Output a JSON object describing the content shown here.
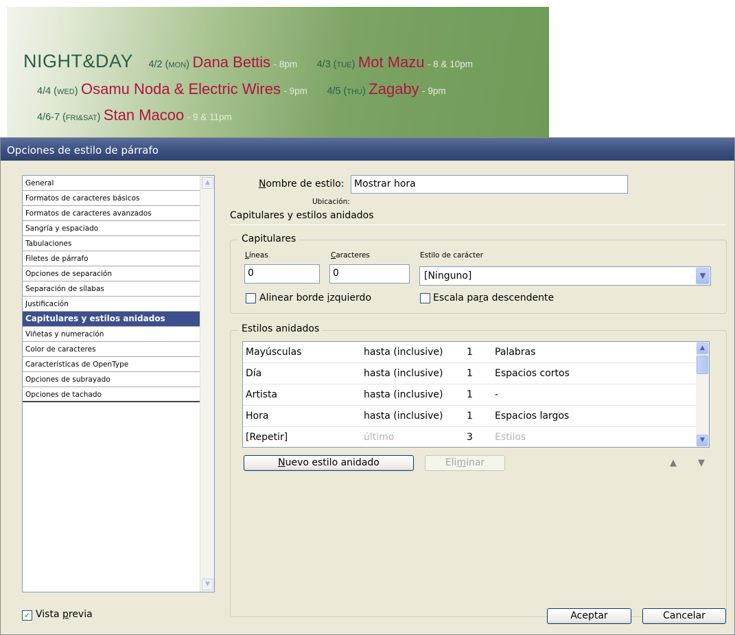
{
  "banner": {
    "title": "NIGHT&DAY",
    "lines": [
      [
        {
          "date_pre": "4/2 (",
          "day_sc": "Mon",
          "date_post": ")",
          "artist": "Dana Bettis",
          "time": "- 8pm"
        },
        {
          "date_pre": "4/3 (",
          "day_sc": "Tue",
          "date_post": ")",
          "artist": "Mot Mazu",
          "time": "- 8 & 10pm"
        }
      ],
      [
        {
          "date_pre": "4/4 (",
          "day_sc": "Wed",
          "date_post": ")",
          "artist": "Osamu Noda & Electric Wires",
          "time": "- 9pm"
        },
        {
          "date_pre": "4/5 (",
          "day_sc": "Thu",
          "date_post": ")",
          "artist": "Zagaby",
          "time": "- 9pm"
        }
      ],
      [
        {
          "date_pre": "4/6-7 (",
          "day_sc": "Fri&Sat",
          "date_post": ")",
          "artist": "Stan Macoo",
          "time": "- 9 & 11pm"
        }
      ]
    ]
  },
  "dialog": {
    "title": "Opciones de estilo de párrafo",
    "categories": [
      "General",
      "Formatos de caracteres básicos",
      "Formatos de caracteres avanzados",
      "Sangría y espaciado",
      "Tabulaciones",
      "Filetes de párrafo",
      "Opciones de separación",
      "Separación de sílabas",
      "Justificación",
      "Capitulares y estilos anidados",
      "Viñetas y numeración",
      "Color de caracteres",
      "Características de OpenType",
      "Opciones de subrayado",
      "Opciones de tachado"
    ],
    "selected_category": "Capitulares y estilos anidados",
    "style_name_label_u": "N",
    "style_name_label_rest": "ombre de estilo:",
    "style_name_value": "Mostrar hora",
    "location_label": "Ubicación:",
    "section_title": "Capitulares y estilos anidados",
    "drop_caps": {
      "legend": "Capitulares",
      "lines_label_u": "L",
      "lines_label_rest": "íneas",
      "lines_value": "0",
      "chars_label_u": "C",
      "chars_label_rest": "aracteres",
      "chars_value": "0",
      "char_style_label": "Estilo de carácter",
      "char_style_value": "[Ninguno]",
      "align_left_pre": "Alinear borde ",
      "align_left_u": "i",
      "align_left_post": "zquierdo",
      "align_left_checked": false,
      "scale_desc_pre": "Escala pa",
      "scale_desc_u": "r",
      "scale_desc_post": "a descendente",
      "scale_desc_checked": false
    },
    "nested": {
      "legend": "Estilos anidados",
      "rows": [
        {
          "style": "Mayúsculas",
          "through": "hasta (inclusive)",
          "count": "1",
          "unit": "Palabras",
          "dim": false
        },
        {
          "style": "Día",
          "through": "hasta (inclusive)",
          "count": "1",
          "unit": "Espacios cortos",
          "dim": false
        },
        {
          "style": "Artista",
          "through": "hasta (inclusive)",
          "count": "1",
          "unit": "-",
          "dim": false
        },
        {
          "style": "Hora",
          "through": "hasta (inclusive)",
          "count": "1",
          "unit": "Espacios largos",
          "dim": false
        },
        {
          "style": "[Repetir]",
          "through": "último",
          "count": "3",
          "unit": "Estilos",
          "dim": true
        }
      ],
      "new_btn_u": "N",
      "new_btn_rest": "uevo estilo anidado",
      "delete_btn_pre": "Eli",
      "delete_btn_u": "m",
      "delete_btn_post": "inar"
    },
    "preview_u": "p",
    "preview_pre": "Vista ",
    "preview_post": "revia",
    "preview_checked": true,
    "ok_label": "Aceptar",
    "cancel_label": "Cancelar"
  }
}
